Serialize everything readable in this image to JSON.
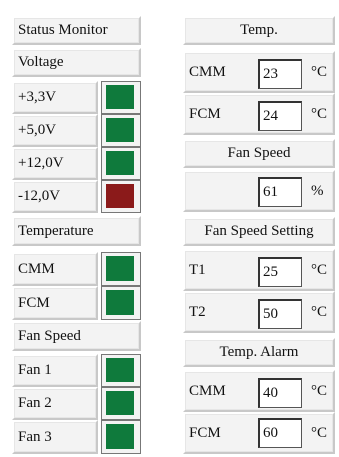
{
  "status_monitor": {
    "title": "Status Monitor",
    "voltage": {
      "header": "Voltage",
      "rows": [
        {
          "label": "+3,3V",
          "status": "ok",
          "color": "#0f7a3c"
        },
        {
          "label": "+5,0V",
          "status": "ok",
          "color": "#0f7a3c"
        },
        {
          "label": "+12,0V",
          "status": "ok",
          "color": "#0f7a3c"
        },
        {
          "label": "-12,0V",
          "status": "fault",
          "color": "#8b1a1a"
        }
      ]
    },
    "temperature": {
      "header": "Temperature",
      "rows": [
        {
          "label": "CMM",
          "status": "ok",
          "color": "#0f7a3c"
        },
        {
          "label": "FCM",
          "status": "ok",
          "color": "#0f7a3c"
        }
      ]
    },
    "fan_speed": {
      "header": "Fan Speed",
      "rows": [
        {
          "label": "Fan 1",
          "status": "ok",
          "color": "#0f7a3c"
        },
        {
          "label": "Fan 2",
          "status": "ok",
          "color": "#0f7a3c"
        },
        {
          "label": "Fan 3",
          "status": "ok",
          "color": "#0f7a3c"
        }
      ]
    }
  },
  "readings": {
    "temp": {
      "header": "Temp.",
      "rows": [
        {
          "label": "CMM",
          "value": "23",
          "unit": "°C"
        },
        {
          "label": "FCM",
          "value": "24",
          "unit": "°C"
        }
      ]
    },
    "fan_speed": {
      "header": "Fan Speed",
      "value": "61",
      "unit": "%"
    },
    "fan_speed_setting": {
      "header": "Fan Speed Setting",
      "rows": [
        {
          "label": "T1",
          "value": "25",
          "unit": "°C"
        },
        {
          "label": "T2",
          "value": "50",
          "unit": "°C"
        }
      ]
    },
    "temp_alarm": {
      "header": "Temp. Alarm",
      "rows": [
        {
          "label": "CMM",
          "value": "40",
          "unit": "°C"
        },
        {
          "label": "FCM",
          "value": "60",
          "unit": "°C"
        }
      ]
    }
  }
}
